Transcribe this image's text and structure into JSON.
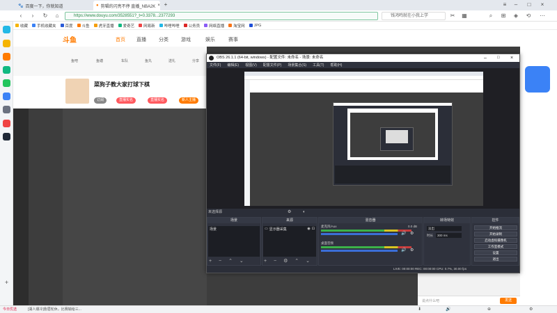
{
  "browser": {
    "tabs": [
      {
        "label": "百度一下，你就知道"
      },
      {
        "label": "剪辑的闪亮不停  直播_NBA2K"
      }
    ],
    "url": "https://www.douyu.com/3528551?_t=0.3378...2377293",
    "search_placeholder": "钱鸿鸣就在小我上学",
    "bookmarks": [
      "收藏",
      "手机收藏夹",
      "百度",
      "斗鱼",
      "虎牙直播",
      "爱奇艺",
      "网易新",
      "哔哩哔哩",
      "公务员",
      "网络直播",
      "淘宝网",
      "JPG"
    ]
  },
  "site": {
    "logo": "斗鱼",
    "nav": [
      "首页",
      "直播",
      "分类",
      "游戏",
      "娱乐",
      "赛事"
    ],
    "sub_items": [
      "鱼吧",
      "鱼塘",
      "车队",
      "鱼丸",
      "送礼",
      "分享",
      "订阅"
    ],
    "room_title": "菜狗子教大家打球下棋",
    "chips": [
      "订阅",
      "直播实名",
      "直播实名",
      "新人主播"
    ],
    "chat_placeholder": "说点什么吧",
    "send_label": "发送"
  },
  "obs": {
    "title": "OBS 26.1.1 (64-bit, windows) - 配置文件: 未命名 - 场景: 未命名",
    "menu": [
      "文件(F)",
      "编辑(E)",
      "视图(V)",
      "配置文件(P)",
      "场景集合(S)",
      "工具(T)",
      "帮助(H)"
    ],
    "scene_bar": "未选择源",
    "docks": {
      "scenes": {
        "title": "场景",
        "items": [
          "场景"
        ]
      },
      "sources": {
        "title": "来源",
        "items": [
          "显示器采集"
        ]
      },
      "mixer": {
        "title": "混音器",
        "channels": [
          "桌面音频",
          "麦克风/Aux"
        ],
        "level": "0.0 dB"
      },
      "transitions": {
        "title": "转场特效",
        "type": "淡出",
        "duration_label": "时长",
        "duration": "300 ms"
      },
      "controls": {
        "title": "控件",
        "buttons": [
          "开始推流",
          "开始录制",
          "启动虚拟摄像机",
          "工作室模式",
          "设置",
          "退出"
        ]
      }
    },
    "status": "LIVE: 00:00:00   REC: 00:00:00   CPU: 0.7%, 30.00 fps"
  },
  "statusbar": {
    "left": "今日优选",
    "news": "[湖人爆冷]詹眉轮休，比赛输给三..."
  }
}
